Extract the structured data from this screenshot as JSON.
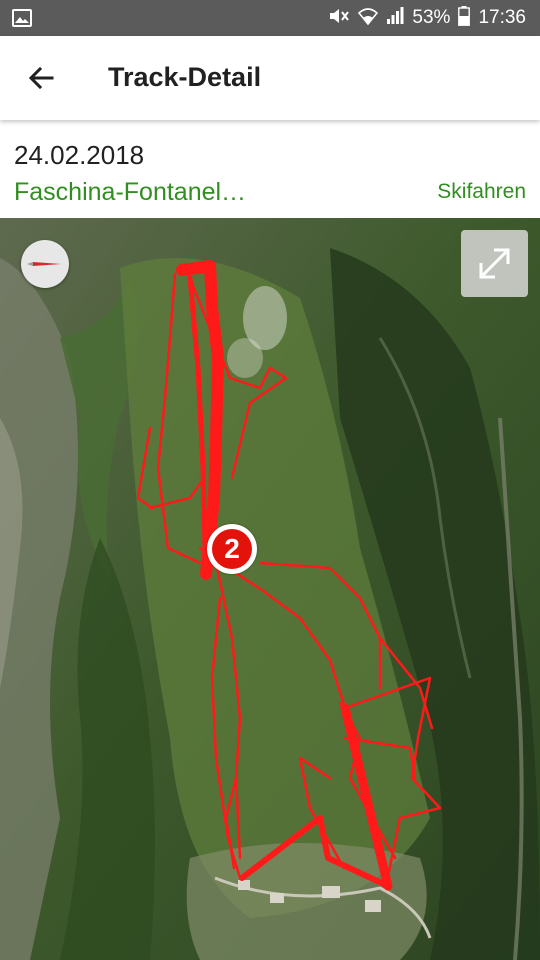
{
  "status_bar": {
    "battery_percent": "53%",
    "time": "17:36",
    "icons": [
      "image-icon",
      "mute-icon",
      "wifi-icon",
      "signal-icon",
      "battery-icon"
    ]
  },
  "app_bar": {
    "title": "Track-Detail",
    "back_icon": "arrow-back-icon"
  },
  "track": {
    "date": "24.02.2018",
    "name": "Faschina-Fontanel…",
    "activity": "Skifahren"
  },
  "map": {
    "marker_label": "2",
    "track_color": "#ff1a1a",
    "compass_icon": "compass-icon",
    "fullscreen_icon": "expand-icon"
  },
  "colors": {
    "accent_green": "#2f8f1f",
    "status_bar": "#5b5b5b",
    "marker_red": "#e3120b"
  }
}
